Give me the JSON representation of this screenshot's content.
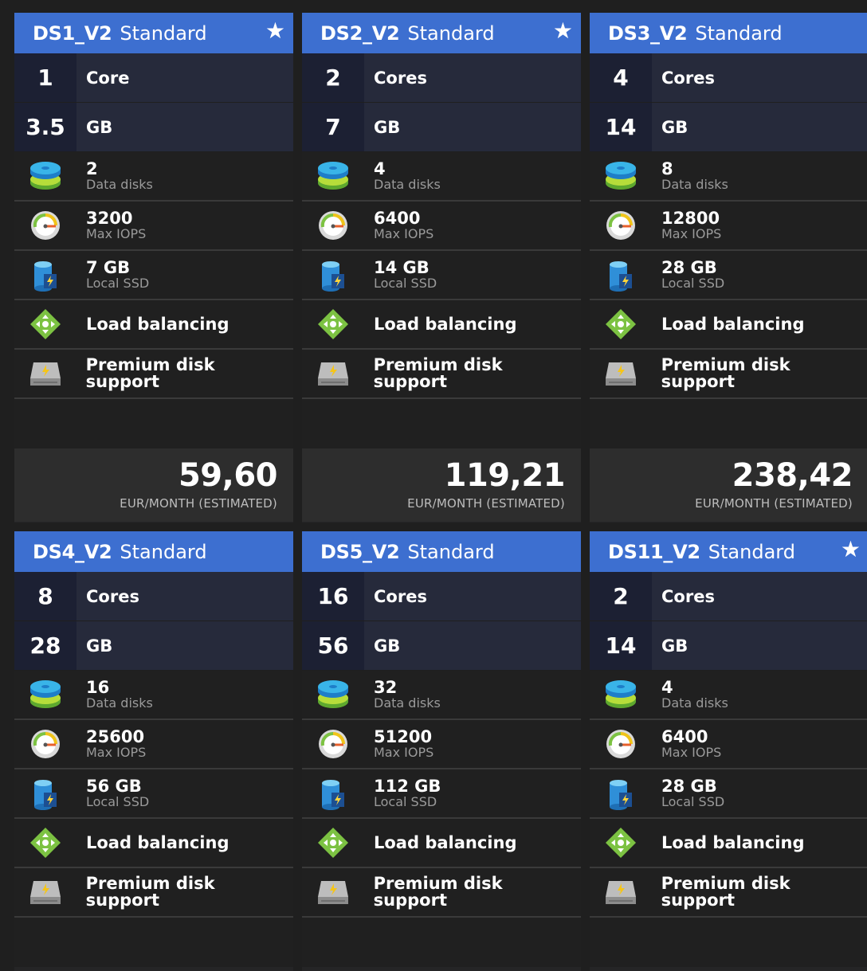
{
  "cards": [
    {
      "name": "DS1_V2",
      "tier": "Standard",
      "starred": true,
      "cores": "1",
      "cores_label": "Core",
      "memory": "3.5",
      "memory_label": "GB",
      "data_disks": "2",
      "data_disks_label": "Data disks",
      "iops": "3200",
      "iops_label": "Max IOPS",
      "ssd": "7 GB",
      "ssd_label": "Local SSD",
      "feature_lb": "Load balancing",
      "feature_premium": "Premium disk support",
      "price": "59,60",
      "price_label": "EUR/MONTH (ESTIMATED)"
    },
    {
      "name": "DS2_V2",
      "tier": "Standard",
      "starred": true,
      "cores": "2",
      "cores_label": "Cores",
      "memory": "7",
      "memory_label": "GB",
      "data_disks": "4",
      "data_disks_label": "Data disks",
      "iops": "6400",
      "iops_label": "Max IOPS",
      "ssd": "14 GB",
      "ssd_label": "Local SSD",
      "feature_lb": "Load balancing",
      "feature_premium": "Premium disk support",
      "price": "119,21",
      "price_label": "EUR/MONTH (ESTIMATED)"
    },
    {
      "name": "DS3_V2",
      "tier": "Standard",
      "starred": false,
      "cores": "4",
      "cores_label": "Cores",
      "memory": "14",
      "memory_label": "GB",
      "data_disks": "8",
      "data_disks_label": "Data disks",
      "iops": "12800",
      "iops_label": "Max IOPS",
      "ssd": "28 GB",
      "ssd_label": "Local SSD",
      "feature_lb": "Load balancing",
      "feature_premium": "Premium disk support",
      "price": "238,42",
      "price_label": "EUR/MONTH (ESTIMATED)"
    },
    {
      "name": "DS4_V2",
      "tier": "Standard",
      "starred": false,
      "cores": "8",
      "cores_label": "Cores",
      "memory": "28",
      "memory_label": "GB",
      "data_disks": "16",
      "data_disks_label": "Data disks",
      "iops": "25600",
      "iops_label": "Max IOPS",
      "ssd": "56 GB",
      "ssd_label": "Local SSD",
      "feature_lb": "Load balancing",
      "feature_premium": "Premium disk support"
    },
    {
      "name": "DS5_V2",
      "tier": "Standard",
      "starred": false,
      "cores": "16",
      "cores_label": "Cores",
      "memory": "56",
      "memory_label": "GB",
      "data_disks": "32",
      "data_disks_label": "Data disks",
      "iops": "51200",
      "iops_label": "Max IOPS",
      "ssd": "112 GB",
      "ssd_label": "Local SSD",
      "feature_lb": "Load balancing",
      "feature_premium": "Premium disk support"
    },
    {
      "name": "DS11_V2",
      "tier": "Standard",
      "starred": true,
      "cores": "2",
      "cores_label": "Cores",
      "memory": "14",
      "memory_label": "GB",
      "data_disks": "4",
      "data_disks_label": "Data disks",
      "iops": "6400",
      "iops_label": "Max IOPS",
      "ssd": "28 GB",
      "ssd_label": "Local SSD",
      "feature_lb": "Load balancing",
      "feature_premium": "Premium disk support"
    }
  ],
  "star_glyph": "★",
  "colors": {
    "header_blue": "#3d6fd0",
    "panel": "#252526",
    "background": "#1f1f1f"
  },
  "icons": {
    "data_disks": "disk-stack-icon",
    "iops": "speedometer-icon",
    "ssd": "ssd-icon",
    "load_balancing": "load-balancer-icon",
    "premium": "premium-disk-icon"
  }
}
